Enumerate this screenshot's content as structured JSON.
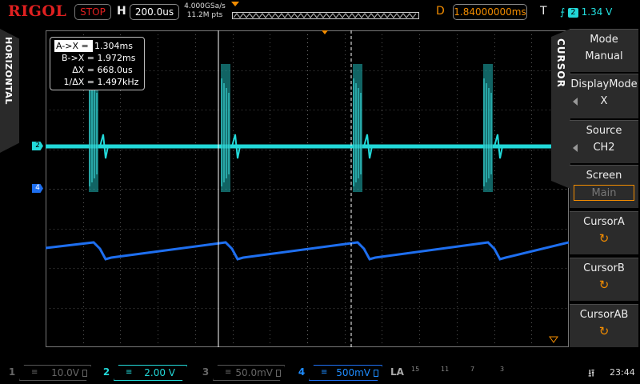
{
  "header": {
    "brand": "RIGOL",
    "run_status": "STOP",
    "horizontal_label": "H",
    "timebase": "200.0us",
    "sample_rate": "4.000GSa/s",
    "memory_depth": "11.2M pts",
    "delay_label": "D",
    "delay": "1.84000000ms",
    "trigger_label": "T",
    "trigger_edge": "rising-edge-icon",
    "trigger_source": "2",
    "trigger_level": "1.34 V"
  },
  "left_tab": {
    "label": "HORIZONTAL"
  },
  "channel_markers": {
    "ch2": "2",
    "ch4": "4"
  },
  "cursor_readout": {
    "rows": [
      {
        "key": "A->X =",
        "value": "1.304ms"
      },
      {
        "key": "B->X =",
        "value": "1.972ms"
      },
      {
        "key": "ΔX =",
        "value": "668.0us"
      },
      {
        "key": "1/ΔX =",
        "value": "1.497kHz"
      }
    ]
  },
  "menu": {
    "tab_label": "CURSOR",
    "mode": {
      "title": "Mode",
      "value": "Manual"
    },
    "display_mode": {
      "title": "DisplayMode",
      "value": "X"
    },
    "source": {
      "title": "Source",
      "value": "CH2"
    },
    "screen": {
      "title": "Screen",
      "value": "Main"
    },
    "cursor_a": {
      "title": "CursorA"
    },
    "cursor_b": {
      "title": "CursorB"
    },
    "cursor_ab": {
      "title": "CursorAB"
    }
  },
  "channels": [
    {
      "num": "1",
      "coupling": "≡",
      "scale": "10.0V",
      "enabled": false
    },
    {
      "num": "2",
      "coupling": "≡",
      "scale": "2.00 V",
      "enabled": true
    },
    {
      "num": "3",
      "coupling": "≡",
      "scale": "50.0mV",
      "enabled": false
    },
    {
      "num": "4",
      "coupling": "≡",
      "scale": "500mV",
      "enabled": true
    }
  ],
  "la": {
    "label": "LA",
    "groups": [
      "15",
      "11",
      "7",
      "3"
    ]
  },
  "status": {
    "time": "23:44",
    "usb_icon": "usb-icon"
  },
  "colors": {
    "ch2": "#22d8d8",
    "ch4": "#1e6ff0",
    "accent": "#f28c00",
    "stop": "#e02020"
  }
}
